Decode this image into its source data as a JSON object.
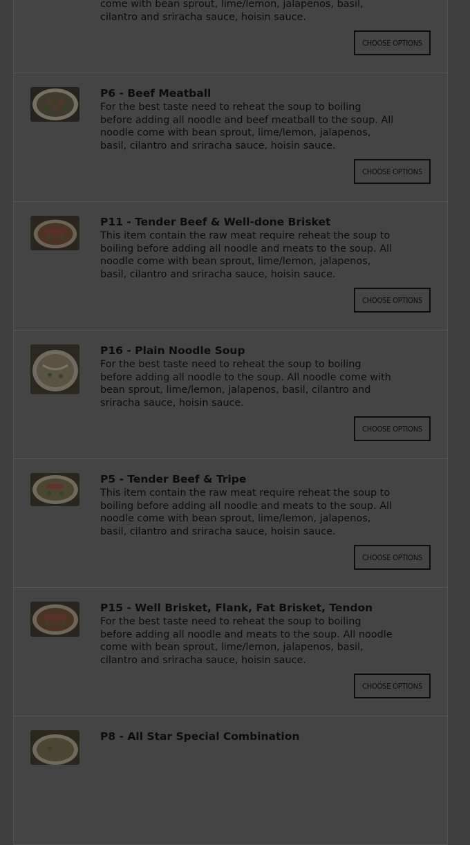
{
  "menu": {
    "items": [
      {
        "title": "",
        "description": "For the best taste need to reheat the soup to boiling before adding all noodle and meats to the soup. All noodle come with bean sprout, lime/lemon, jalapenos, basil, cilantro and sriracha sauce, hoisin sauce.",
        "button_label": "CHOOSE OPTIONS"
      },
      {
        "title": "P6 - Beef Meatball",
        "description": "For the best taste need to reheat the soup to boiling before adding all noodle and beef meatball to the soup. All noodle come with bean sprout, lime/lemon, jalapenos, basil, cilantro and sriracha sauce, hoisin sauce.",
        "button_label": "CHOOSE OPTIONS"
      },
      {
        "title": "P11 - Tender Beef & Well-done Brisket",
        "description": "This item contain the raw meat require reheat the soup to boiling before adding all noodle and meats to the soup. All noodle come with bean sprout, lime/lemon, jalapenos, basil, cilantro and sriracha sauce, hoisin sauce.",
        "button_label": "CHOOSE OPTIONS"
      },
      {
        "title": "P16 - Plain Noodle Soup",
        "description": "For the best taste need to reheat the soup to boiling before adding all noodle to the soup. All noodle come with bean sprout, lime/lemon, jalapenos, basil, cilantro and sriracha sauce, hoisin sauce.",
        "button_label": "CHOOSE OPTIONS"
      },
      {
        "title": "P5 - Tender Beef & Tripe",
        "description": "This item contain the raw meat require reheat the soup to boiling before adding all noodle and meats to the soup. All noodle come with bean sprout, lime/lemon, jalapenos, basil, cilantro and sriracha sauce, hoisin sauce.",
        "button_label": "CHOOSE OPTIONS"
      },
      {
        "title": "P15 - Well Brisket, Flank, Fat Brisket, Tendon",
        "description": "For the best taste need to reheat the soup to boiling before adding all noodle and meats to the soup. All noodle come with bean sprout, lime/lemon, jalapenos, basil, cilantro and sriracha sauce, hoisin sauce.",
        "button_label": "CHOOSE OPTIONS"
      },
      {
        "title": "P8 - All Star Special Combination",
        "description": "",
        "button_label": ""
      }
    ]
  }
}
